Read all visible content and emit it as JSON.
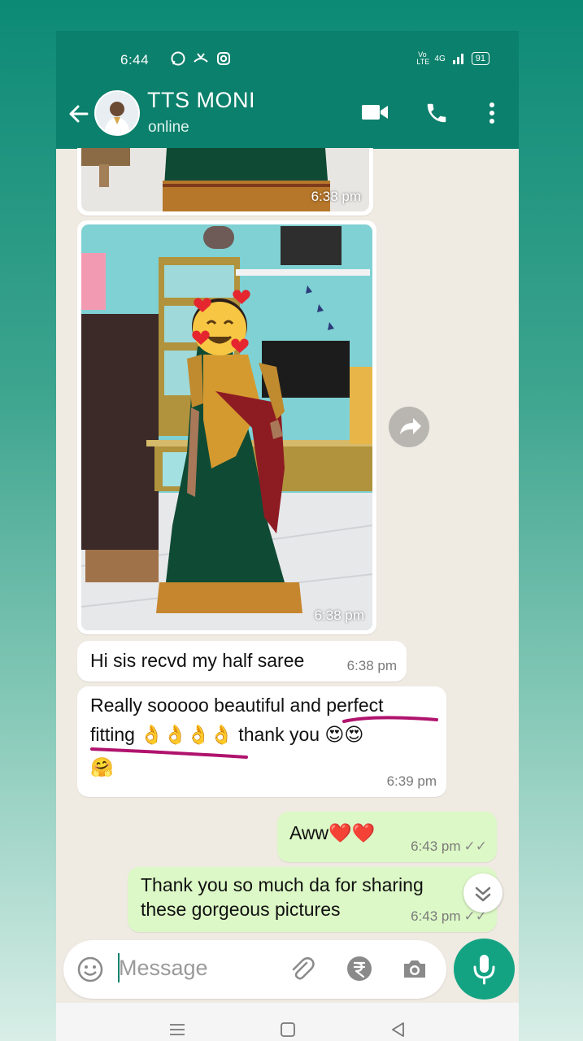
{
  "status": {
    "time": "6:44",
    "network": "4G",
    "volte": "Vo LTE",
    "battery": "91"
  },
  "header": {
    "name": "TTS MONI",
    "status": "online"
  },
  "messages": {
    "img1_time": "6:38 pm",
    "img2_time": "6:38 pm",
    "msg1_text": "Hi sis recvd my half saree",
    "msg1_time": "6:38 pm",
    "msg2_line1": "Really sooooo beautiful and perfect",
    "msg2_line2": "fitting 👌👌👌👌 thank you 😍😍",
    "msg2_line3": "🤗",
    "msg2_time": "6:39 pm",
    "msg3_text": "Aww❤️❤️",
    "msg3_time": "6:43 pm",
    "msg4_line1": "Thank you so much da for sharing",
    "msg4_line2": "these gorgeous pictures",
    "msg4_time": "6:43 pm"
  },
  "composer": {
    "placeholder": "Message"
  },
  "colors": {
    "header": "#0b806c",
    "accent": "#13a383",
    "outgoing": "#dcf8c6",
    "annotation": "#b0136e"
  }
}
